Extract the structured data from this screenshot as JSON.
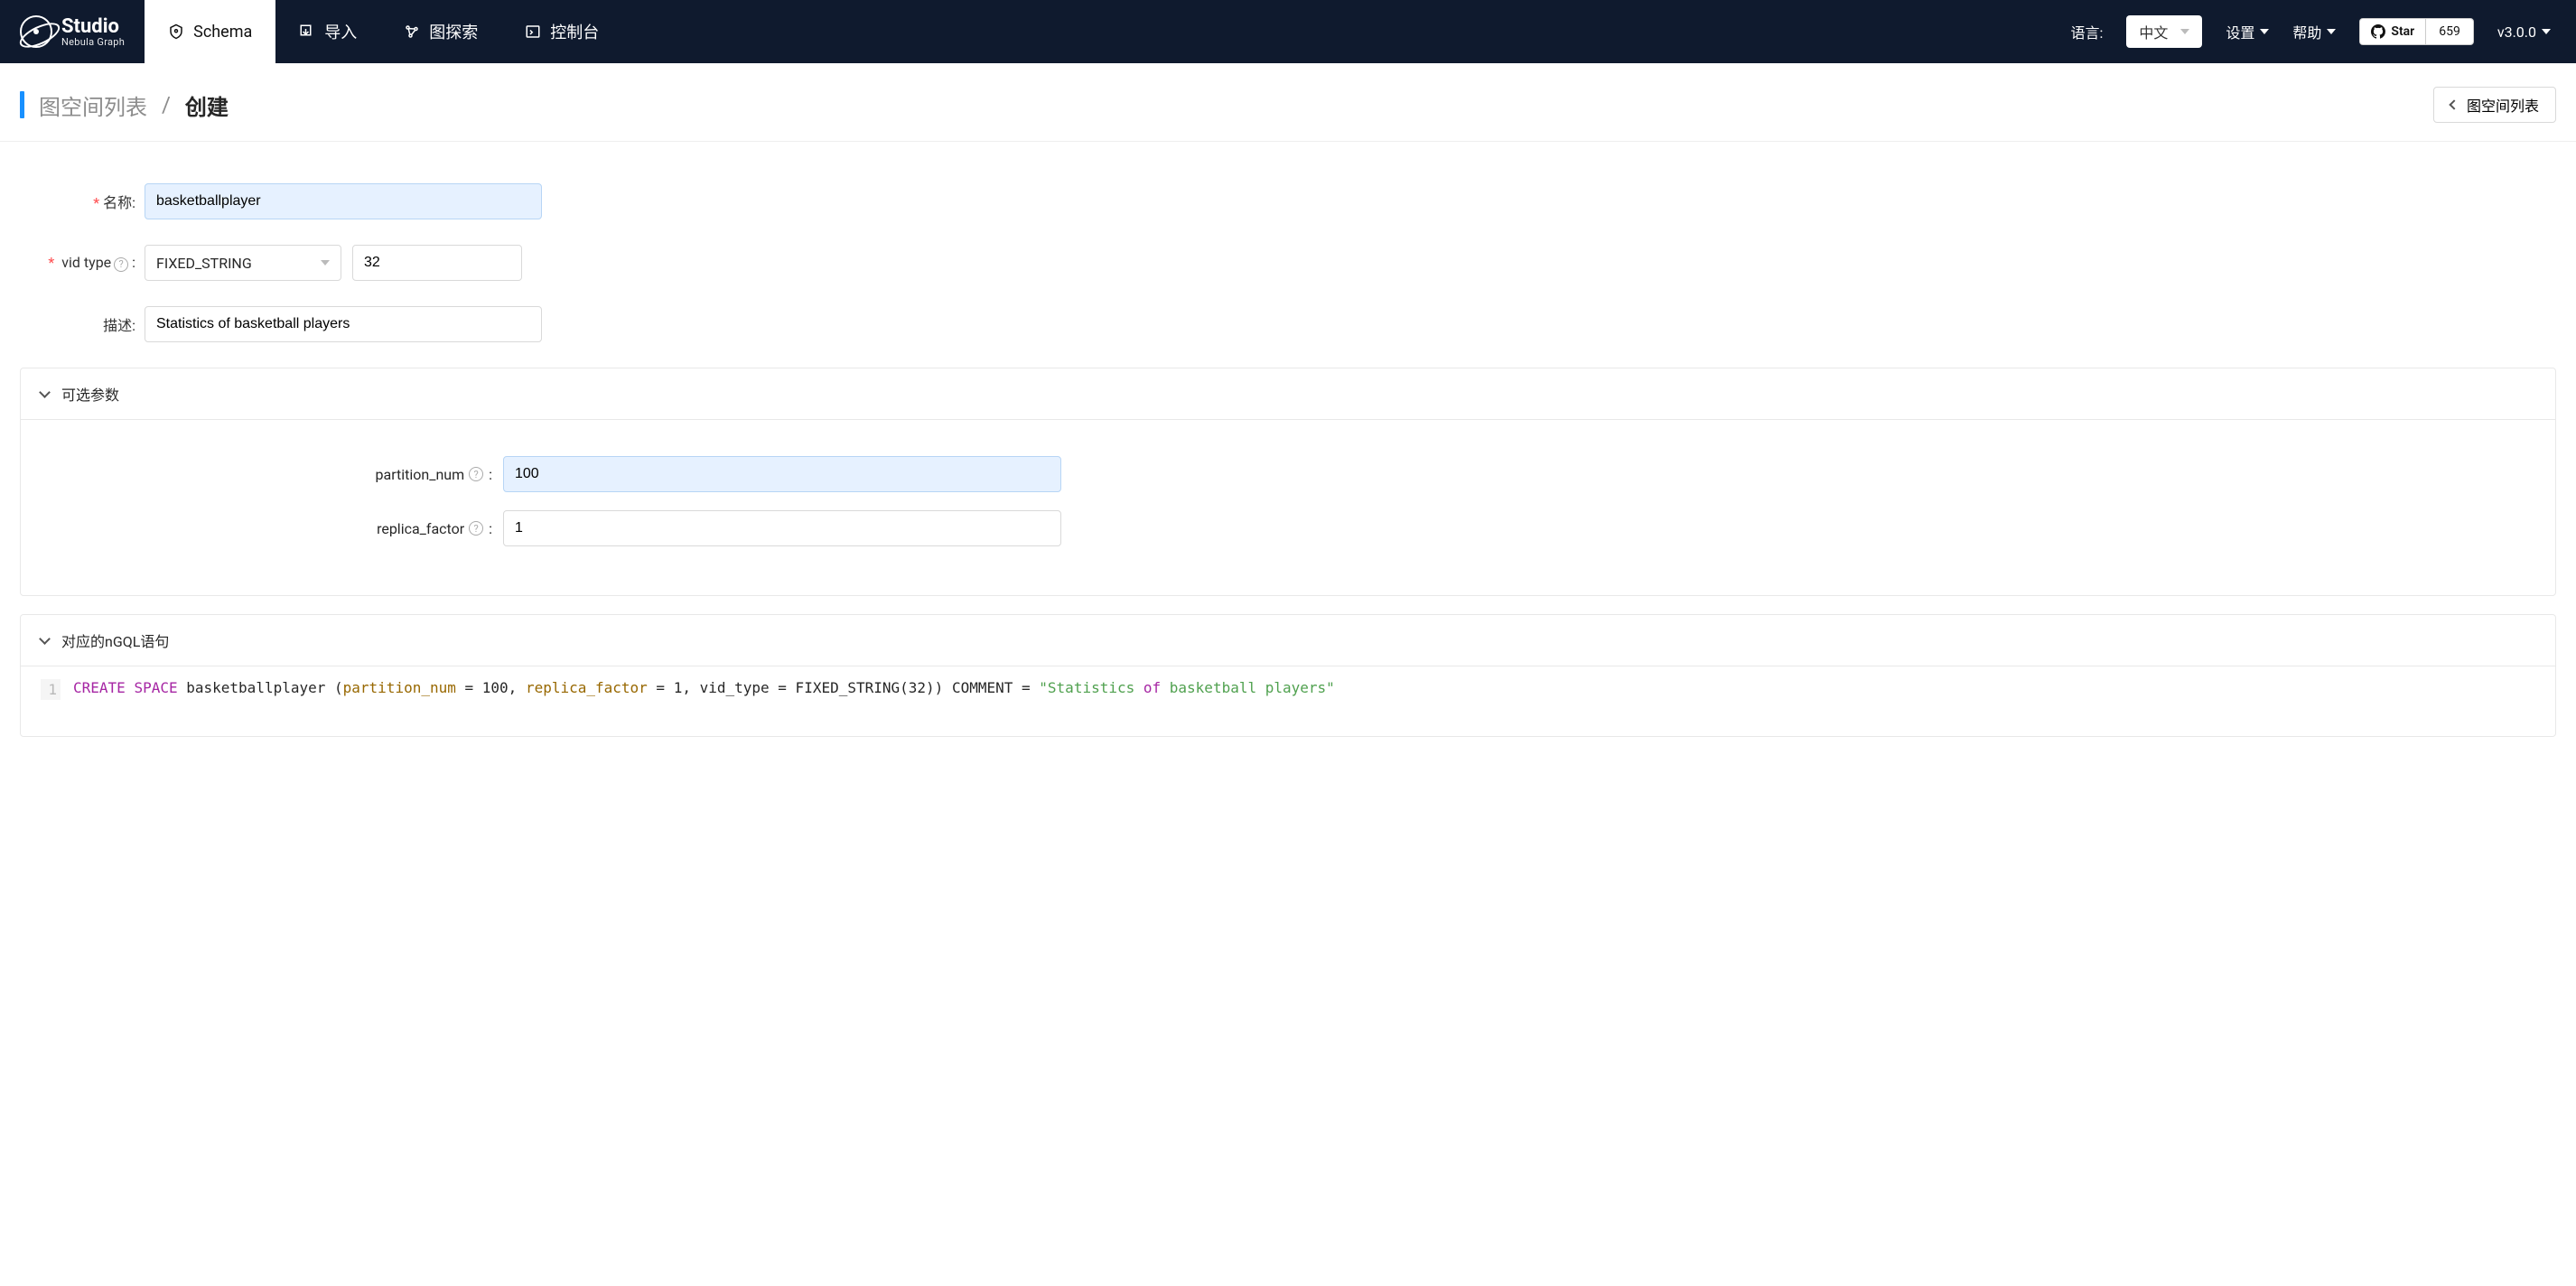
{
  "brand": {
    "title": "Studio",
    "subtitle": "Nebula Graph"
  },
  "nav": {
    "tabs": [
      {
        "label": "Schema",
        "active": true
      },
      {
        "label": "导入"
      },
      {
        "label": "图探索"
      },
      {
        "label": "控制台"
      }
    ],
    "language_label": "语言:",
    "language_value": "中文",
    "settings_label": "设置",
    "help_label": "帮助",
    "github_star_label": "Star",
    "github_star_count": "659",
    "version": "v3.0.0"
  },
  "breadcrumb": {
    "parent": "图空间列表",
    "current": "创建",
    "back_button": "图空间列表"
  },
  "form": {
    "name_label": "名称:",
    "name_value": "basketballplayer",
    "vidtype_label": "vid type",
    "vidtype_value": "FIXED_STRING",
    "vidtype_len": "32",
    "desc_label": "描述:",
    "desc_value": "Statistics of basketball players"
  },
  "panels": {
    "optional_title": "可选参数",
    "partition_label": "partition_num",
    "partition_value": "100",
    "replica_label": "replica_factor",
    "replica_value": "1",
    "ngql_title": "对应的nGQL语句"
  },
  "code": {
    "line_no": "1",
    "kw_create": "CREATE",
    "kw_space": "SPACE",
    "ident": "basketballplayer",
    "open": " (",
    "p_partition": "partition_num",
    "eq1": " = 100, ",
    "p_replica": "replica_factor",
    "tail": " = 1, vid_type = FIXED_STRING(32)) COMMENT = ",
    "str_open": "\"Statistics ",
    "kw_of": "of",
    "str_close": " basketball players\""
  },
  "colors": {
    "nav_bg": "#0f1a2e",
    "accent": "#1890ff"
  }
}
